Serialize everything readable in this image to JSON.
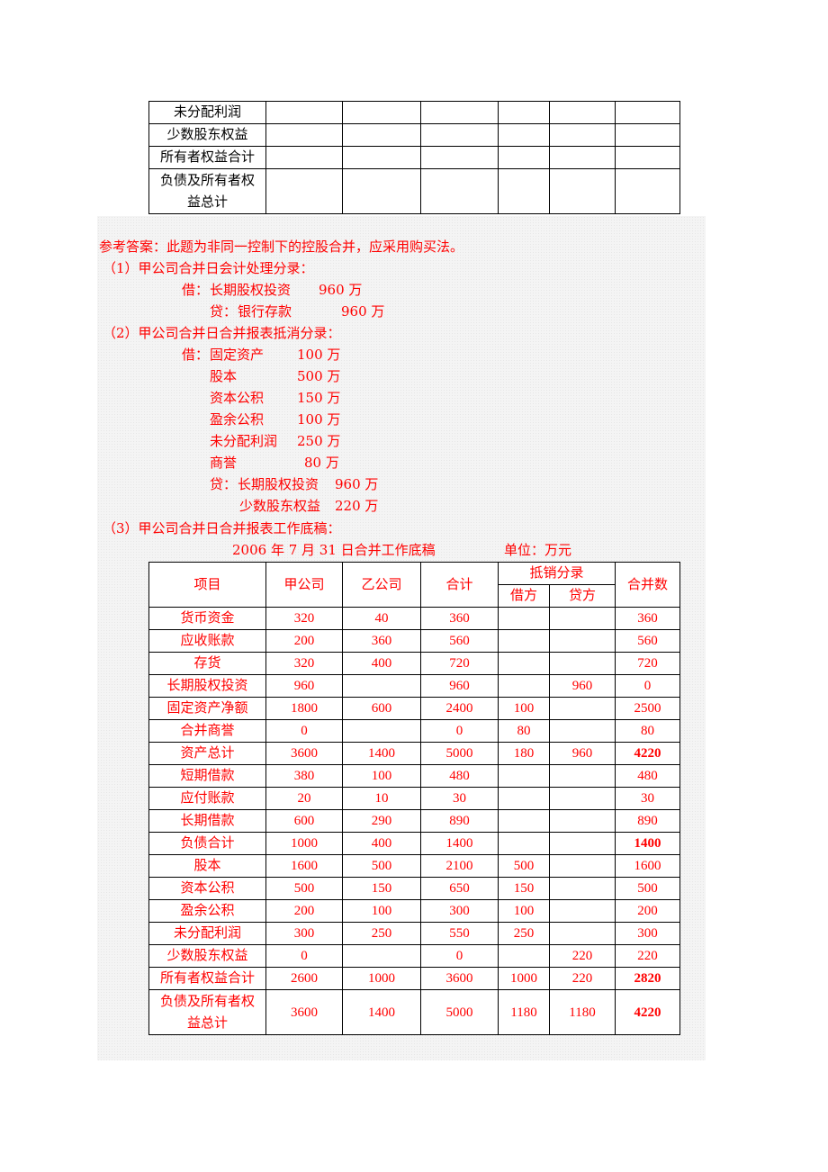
{
  "top_table": {
    "rows": [
      {
        "label": "未分配利润",
        "cells": [
          "",
          "",
          "",
          "",
          "",
          ""
        ]
      },
      {
        "label": "少数股东权益",
        "cells": [
          "",
          "",
          "",
          "",
          "",
          ""
        ]
      },
      {
        "label": "所有者权益合计",
        "cells": [
          "",
          "",
          "",
          "",
          "",
          ""
        ]
      },
      {
        "label": "负债及所有者权益总计",
        "label_line1": "负债及所有者权",
        "label_line2": "益总计",
        "cells": [
          "",
          "",
          "",
          "",
          "",
          ""
        ]
      }
    ]
  },
  "answer": {
    "intro": "参考答案：此题为非同一控制下的控股合并，应采用购买法。",
    "part1": {
      "title": "（1）甲公司合并日会计处理分录：",
      "debit": {
        "prefix": "借：",
        "account": "长期股权投资",
        "amount": "960 万"
      },
      "credit": {
        "prefix": "贷：",
        "account": "银行存款",
        "amount": "960 万"
      }
    },
    "part2": {
      "title": "（2）甲公司合并日合并报表抵消分录：",
      "debit_prefix": "借：",
      "debits": [
        {
          "account": "固定资产",
          "amount": "100 万"
        },
        {
          "account": "股本",
          "amount": "500 万"
        },
        {
          "account": "资本公积",
          "amount": "150 万"
        },
        {
          "account": "盈余公积",
          "amount": "100 万"
        },
        {
          "account": "未分配利润",
          "amount": "250 万"
        },
        {
          "account": "商誉",
          "amount": "80 万"
        }
      ],
      "credit_prefix": "贷：",
      "credits": [
        {
          "account": "长期股权投资",
          "amount": "960 万"
        },
        {
          "account": "少数股东权益",
          "amount": "220 万"
        }
      ]
    },
    "part3": {
      "title": "（3）甲公司合并日合并报表工作底稿：",
      "caption": "2006 年 7 月 31 日合并工作底稿",
      "unit": "单位：万元"
    }
  },
  "main_table": {
    "headers": {
      "item": "项目",
      "company_a": "甲公司",
      "company_b": "乙公司",
      "total": "合计",
      "elimination": "抵销分录",
      "debit": "借方",
      "credit": "贷方",
      "consolidated": "合并数"
    },
    "rows": [
      {
        "item": "货币资金",
        "a": "320",
        "b": "40",
        "total": "360",
        "debit": "",
        "credit": "",
        "consolidated": "360",
        "bold": false
      },
      {
        "item": "应收账款",
        "a": "200",
        "b": "360",
        "total": "560",
        "debit": "",
        "credit": "",
        "consolidated": "560",
        "bold": false
      },
      {
        "item": "存货",
        "a": "320",
        "b": "400",
        "total": "720",
        "debit": "",
        "credit": "",
        "consolidated": "720",
        "bold": false
      },
      {
        "item": "长期股权投资",
        "a": "960",
        "b": "",
        "total": "960",
        "debit": "",
        "credit": "960",
        "consolidated": "0",
        "bold": false
      },
      {
        "item": "固定资产净额",
        "a": "1800",
        "b": "600",
        "total": "2400",
        "debit": "100",
        "credit": "",
        "consolidated": "2500",
        "bold": false
      },
      {
        "item": "合并商誉",
        "a": "0",
        "b": "",
        "total": "0",
        "debit": "80",
        "credit": "",
        "consolidated": "80",
        "bold": false
      },
      {
        "item": "资产总计",
        "a": "3600",
        "b": "1400",
        "total": "5000",
        "debit": "180",
        "credit": "960",
        "consolidated": "4220",
        "bold": true
      },
      {
        "item": "短期借款",
        "a": "380",
        "b": "100",
        "total": "480",
        "debit": "",
        "credit": "",
        "consolidated": "480",
        "bold": false
      },
      {
        "item": "应付账款",
        "a": "20",
        "b": "10",
        "total": "30",
        "debit": "",
        "credit": "",
        "consolidated": "30",
        "bold": false
      },
      {
        "item": "长期借款",
        "a": "600",
        "b": "290",
        "total": "890",
        "debit": "",
        "credit": "",
        "consolidated": "890",
        "bold": false
      },
      {
        "item": "负债合计",
        "a": "1000",
        "b": "400",
        "total": "1400",
        "debit": "",
        "credit": "",
        "consolidated": "1400",
        "bold": true
      },
      {
        "item": "股本",
        "a": "1600",
        "b": "500",
        "total": "2100",
        "debit": "500",
        "credit": "",
        "consolidated": "1600",
        "bold": false
      },
      {
        "item": "资本公积",
        "a": "500",
        "b": "150",
        "total": "650",
        "debit": "150",
        "credit": "",
        "consolidated": "500",
        "bold": false
      },
      {
        "item": "盈余公积",
        "a": "200",
        "b": "100",
        "total": "300",
        "debit": "100",
        "credit": "",
        "consolidated": "200",
        "bold": false
      },
      {
        "item": "未分配利润",
        "a": "300",
        "b": "250",
        "total": "550",
        "debit": "250",
        "credit": "",
        "consolidated": "300",
        "bold": false
      },
      {
        "item": "少数股东权益",
        "a": "0",
        "b": "",
        "total": "0",
        "debit": "",
        "credit": "220",
        "consolidated": "220",
        "bold": false
      },
      {
        "item": "所有者权益合计",
        "a": "2600",
        "b": "1000",
        "total": "3600",
        "debit": "1000",
        "credit": "220",
        "consolidated": "2820",
        "bold": true
      },
      {
        "item_line1": "负债及所有者权",
        "item_line2": "益总计",
        "item": "负债及所有者权益总计",
        "a": "3600",
        "b": "1400",
        "total": "5000",
        "debit": "1180",
        "credit": "1180",
        "consolidated": "4220",
        "bold": true
      }
    ]
  },
  "colors": {
    "answer_text": "#ff0000",
    "body_text": "#000000",
    "answer_background": "#f4f4f4"
  }
}
